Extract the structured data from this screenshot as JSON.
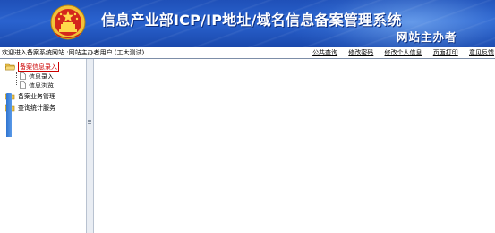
{
  "header": {
    "title": "信息产业部ICP/IP地址/域名信息备案管理系统",
    "subtitle": "网站主办者",
    "emblem_icon": "national-emblem-icon"
  },
  "topbar": {
    "welcome": "欢迎进入备案系统网站 :网站主办者用户 (工大测试)",
    "links": [
      "公共查询",
      "修改密码",
      "修改个人信息",
      "页面打印",
      "意见反馈"
    ]
  },
  "nav": {
    "items": [
      {
        "label": "备案信息录入",
        "selected": true,
        "children": [
          "信息录入",
          "信息浏览"
        ]
      },
      {
        "label": "备案业务管理",
        "selected": false
      },
      {
        "label": "查询统计服务",
        "selected": false
      }
    ]
  },
  "colors": {
    "banner": "#2a63cf",
    "selected_text": "#cc0000",
    "scroll_accent": "#2f74d0"
  }
}
